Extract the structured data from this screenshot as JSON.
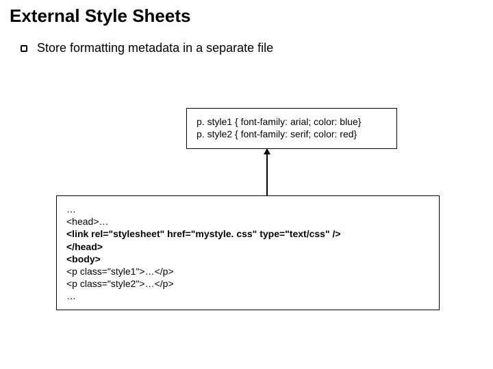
{
  "title": "External Style Sheets",
  "bullet": "Store formatting metadata in a separate file",
  "cssBox": {
    "line1": "p. style1 { font-family: arial; color: blue}",
    "line2": "p. style2 { font-family: serif; color: red}"
  },
  "htmlBox": {
    "l1": "…",
    "l2": "<head>…",
    "l3": "<link rel=\"stylesheet\" href=\"mystyle. css\" type=\"text/css\" />",
    "l4": "</head>",
    "l5": "<body>",
    "l6": "<p class=\"style1\">…</p>",
    "l7": "<p class=\"style2\">…</p>",
    "l8": "…"
  }
}
